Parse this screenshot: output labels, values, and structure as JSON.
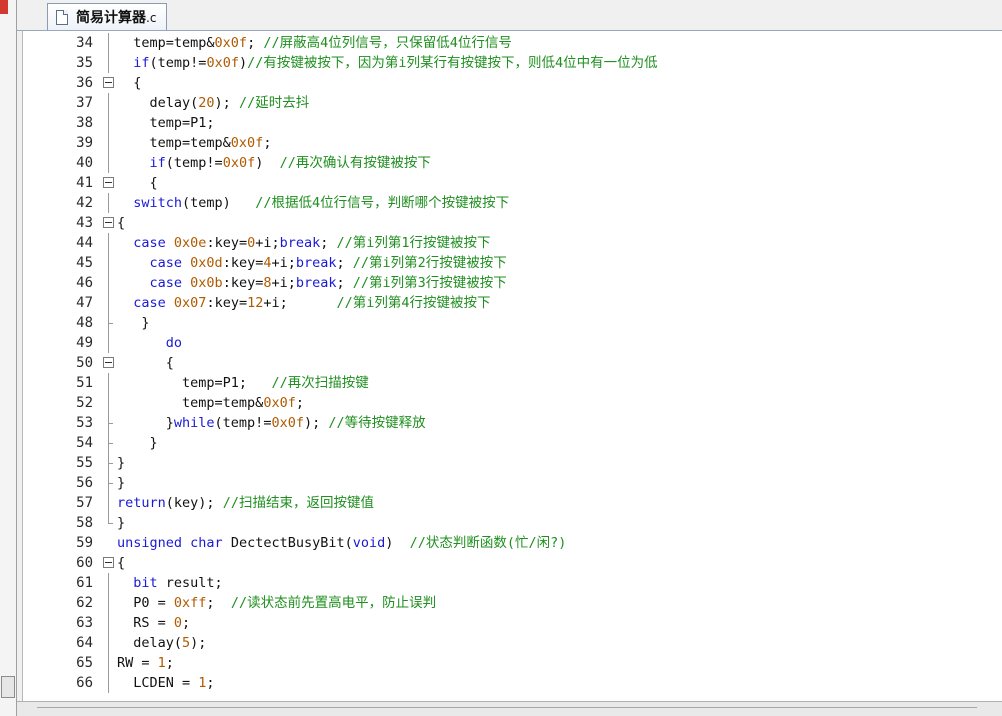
{
  "tab": {
    "name": "简易计算器",
    "ext": ".c"
  },
  "colors": {
    "keyword": "#1a1ad6",
    "number": "#b05a00",
    "comment": "#1f8f1f",
    "text": "#111111"
  },
  "lines": [
    {
      "n": "34",
      "fold": "vline",
      "segs": [
        [
          "t",
          "  temp=temp&"
        ],
        [
          "num",
          "0x0f"
        ],
        [
          "t",
          "; "
        ],
        [
          "cm",
          "//屏蔽高4位列信号，只保留低4位行信号"
        ]
      ]
    },
    {
      "n": "35",
      "fold": "vline",
      "segs": [
        [
          "t",
          "  "
        ],
        [
          "kw",
          "if"
        ],
        [
          "t",
          "(temp!="
        ],
        [
          "num",
          "0x0f"
        ],
        [
          "t",
          ")"
        ],
        [
          "cm",
          "//有按键被按下，因为第i列某行有按键按下，则低4位中有一位为低"
        ]
      ]
    },
    {
      "n": "36",
      "fold": "box",
      "segs": [
        [
          "t",
          "  {"
        ]
      ]
    },
    {
      "n": "37",
      "fold": "vline",
      "segs": [
        [
          "t",
          "    delay("
        ],
        [
          "num",
          "20"
        ],
        [
          "t",
          "); "
        ],
        [
          "cm",
          "//延时去抖"
        ]
      ]
    },
    {
      "n": "38",
      "fold": "vline",
      "segs": [
        [
          "t",
          "    temp=P1;"
        ]
      ]
    },
    {
      "n": "39",
      "fold": "vline",
      "segs": [
        [
          "t",
          "    temp=temp&"
        ],
        [
          "num",
          "0x0f"
        ],
        [
          "t",
          ";"
        ]
      ]
    },
    {
      "n": "40",
      "fold": "vline",
      "segs": [
        [
          "t",
          "    "
        ],
        [
          "kw",
          "if"
        ],
        [
          "t",
          "(temp!="
        ],
        [
          "num",
          "0x0f"
        ],
        [
          "t",
          ")  "
        ],
        [
          "cm",
          "//再次确认有按键被按下"
        ]
      ]
    },
    {
      "n": "41",
      "fold": "box",
      "segs": [
        [
          "t",
          "    {"
        ]
      ]
    },
    {
      "n": "42",
      "fold": "vline",
      "segs": [
        [
          "t",
          "  "
        ],
        [
          "kw",
          "switch"
        ],
        [
          "t",
          "(temp)   "
        ],
        [
          "cm",
          "//根据低4位行信号，判断哪个按键被按下"
        ]
      ]
    },
    {
      "n": "43",
      "fold": "box",
      "segs": [
        [
          "t",
          "{"
        ]
      ]
    },
    {
      "n": "44",
      "fold": "vline",
      "segs": [
        [
          "t",
          "  "
        ],
        [
          "kw",
          "case"
        ],
        [
          "t",
          " "
        ],
        [
          "num",
          "0x0e"
        ],
        [
          "t",
          ":key="
        ],
        [
          "num",
          "0"
        ],
        [
          "t",
          "+i;"
        ],
        [
          "kw",
          "break"
        ],
        [
          "t",
          "; "
        ],
        [
          "cm",
          "//第i列第1行按键被按下"
        ]
      ]
    },
    {
      "n": "45",
      "fold": "vline",
      "segs": [
        [
          "t",
          "    "
        ],
        [
          "kw",
          "case"
        ],
        [
          "t",
          " "
        ],
        [
          "num",
          "0x0d"
        ],
        [
          "t",
          ":key="
        ],
        [
          "num",
          "4"
        ],
        [
          "t",
          "+i;"
        ],
        [
          "kw",
          "break"
        ],
        [
          "t",
          "; "
        ],
        [
          "cm",
          "//第i列第2行按键被按下"
        ]
      ]
    },
    {
      "n": "46",
      "fold": "vline",
      "segs": [
        [
          "t",
          "    "
        ],
        [
          "kw",
          "case"
        ],
        [
          "t",
          " "
        ],
        [
          "num",
          "0x0b"
        ],
        [
          "t",
          ":key="
        ],
        [
          "num",
          "8"
        ],
        [
          "t",
          "+i;"
        ],
        [
          "kw",
          "break"
        ],
        [
          "t",
          "; "
        ],
        [
          "cm",
          "//第i列第3行按键被按下"
        ]
      ]
    },
    {
      "n": "47",
      "fold": "vline",
      "segs": [
        [
          "t",
          "  "
        ],
        [
          "kw",
          "case"
        ],
        [
          "t",
          " "
        ],
        [
          "num",
          "0x07"
        ],
        [
          "t",
          ":key="
        ],
        [
          "num",
          "12"
        ],
        [
          "t",
          "+i;      "
        ],
        [
          "cm",
          "//第i列第4行按键被按下"
        ]
      ]
    },
    {
      "n": "48",
      "fold": "mid",
      "segs": [
        [
          "t",
          "   }"
        ]
      ]
    },
    {
      "n": "49",
      "fold": "vline",
      "segs": [
        [
          "t",
          "      "
        ],
        [
          "kw",
          "do"
        ]
      ]
    },
    {
      "n": "50",
      "fold": "box",
      "segs": [
        [
          "t",
          "      {"
        ]
      ]
    },
    {
      "n": "51",
      "fold": "vline",
      "segs": [
        [
          "t",
          "        temp=P1;   "
        ],
        [
          "cm",
          "//再次扫描按键"
        ]
      ]
    },
    {
      "n": "52",
      "fold": "vline",
      "segs": [
        [
          "t",
          "        temp=temp&"
        ],
        [
          "num",
          "0x0f"
        ],
        [
          "t",
          ";"
        ]
      ]
    },
    {
      "n": "53",
      "fold": "mid",
      "segs": [
        [
          "t",
          "      }"
        ],
        [
          "kw",
          "while"
        ],
        [
          "t",
          "(temp!="
        ],
        [
          "num",
          "0x0f"
        ],
        [
          "t",
          "); "
        ],
        [
          "cm",
          "//等待按键释放"
        ]
      ]
    },
    {
      "n": "54",
      "fold": "mid",
      "segs": [
        [
          "t",
          "    }"
        ]
      ]
    },
    {
      "n": "55",
      "fold": "mid",
      "segs": [
        [
          "t",
          "}"
        ]
      ]
    },
    {
      "n": "56",
      "fold": "mid",
      "segs": [
        [
          "t",
          "}"
        ]
      ]
    },
    {
      "n": "57",
      "fold": "vline",
      "segs": [
        [
          "kw",
          "return"
        ],
        [
          "t",
          "(key); "
        ],
        [
          "cm",
          "//扫描结束，返回按键值"
        ]
      ]
    },
    {
      "n": "58",
      "fold": "end",
      "segs": [
        [
          "t",
          "}"
        ]
      ]
    },
    {
      "n": "59",
      "fold": "",
      "segs": [
        [
          "kw",
          "unsigned"
        ],
        [
          "t",
          " "
        ],
        [
          "kw",
          "char"
        ],
        [
          "t",
          " DectectBusyBit("
        ],
        [
          "kw",
          "void"
        ],
        [
          "t",
          ")  "
        ],
        [
          "cm",
          "//状态判断函数(忙/闲?)"
        ]
      ]
    },
    {
      "n": "60",
      "fold": "box",
      "segs": [
        [
          "t",
          "{"
        ]
      ]
    },
    {
      "n": "61",
      "fold": "vline",
      "segs": [
        [
          "t",
          "  "
        ],
        [
          "kw",
          "bit"
        ],
        [
          "t",
          " result;"
        ]
      ]
    },
    {
      "n": "62",
      "fold": "vline",
      "segs": [
        [
          "t",
          "  P0 = "
        ],
        [
          "num",
          "0xff"
        ],
        [
          "t",
          ";  "
        ],
        [
          "cm",
          "//读状态前先置高电平，防止误判"
        ]
      ]
    },
    {
      "n": "63",
      "fold": "vline",
      "segs": [
        [
          "t",
          "  RS = "
        ],
        [
          "num",
          "0"
        ],
        [
          "t",
          ";"
        ]
      ]
    },
    {
      "n": "64",
      "fold": "vline",
      "segs": [
        [
          "t",
          "  delay("
        ],
        [
          "num",
          "5"
        ],
        [
          "t",
          ");"
        ]
      ]
    },
    {
      "n": "65",
      "fold": "vline",
      "segs": [
        [
          "t",
          "RW = "
        ],
        [
          "num",
          "1"
        ],
        [
          "t",
          ";"
        ]
      ]
    },
    {
      "n": "66",
      "fold": "vline",
      "segs": [
        [
          "t",
          "  LCDEN = "
        ],
        [
          "num",
          "1"
        ],
        [
          "t",
          ";"
        ]
      ]
    }
  ]
}
